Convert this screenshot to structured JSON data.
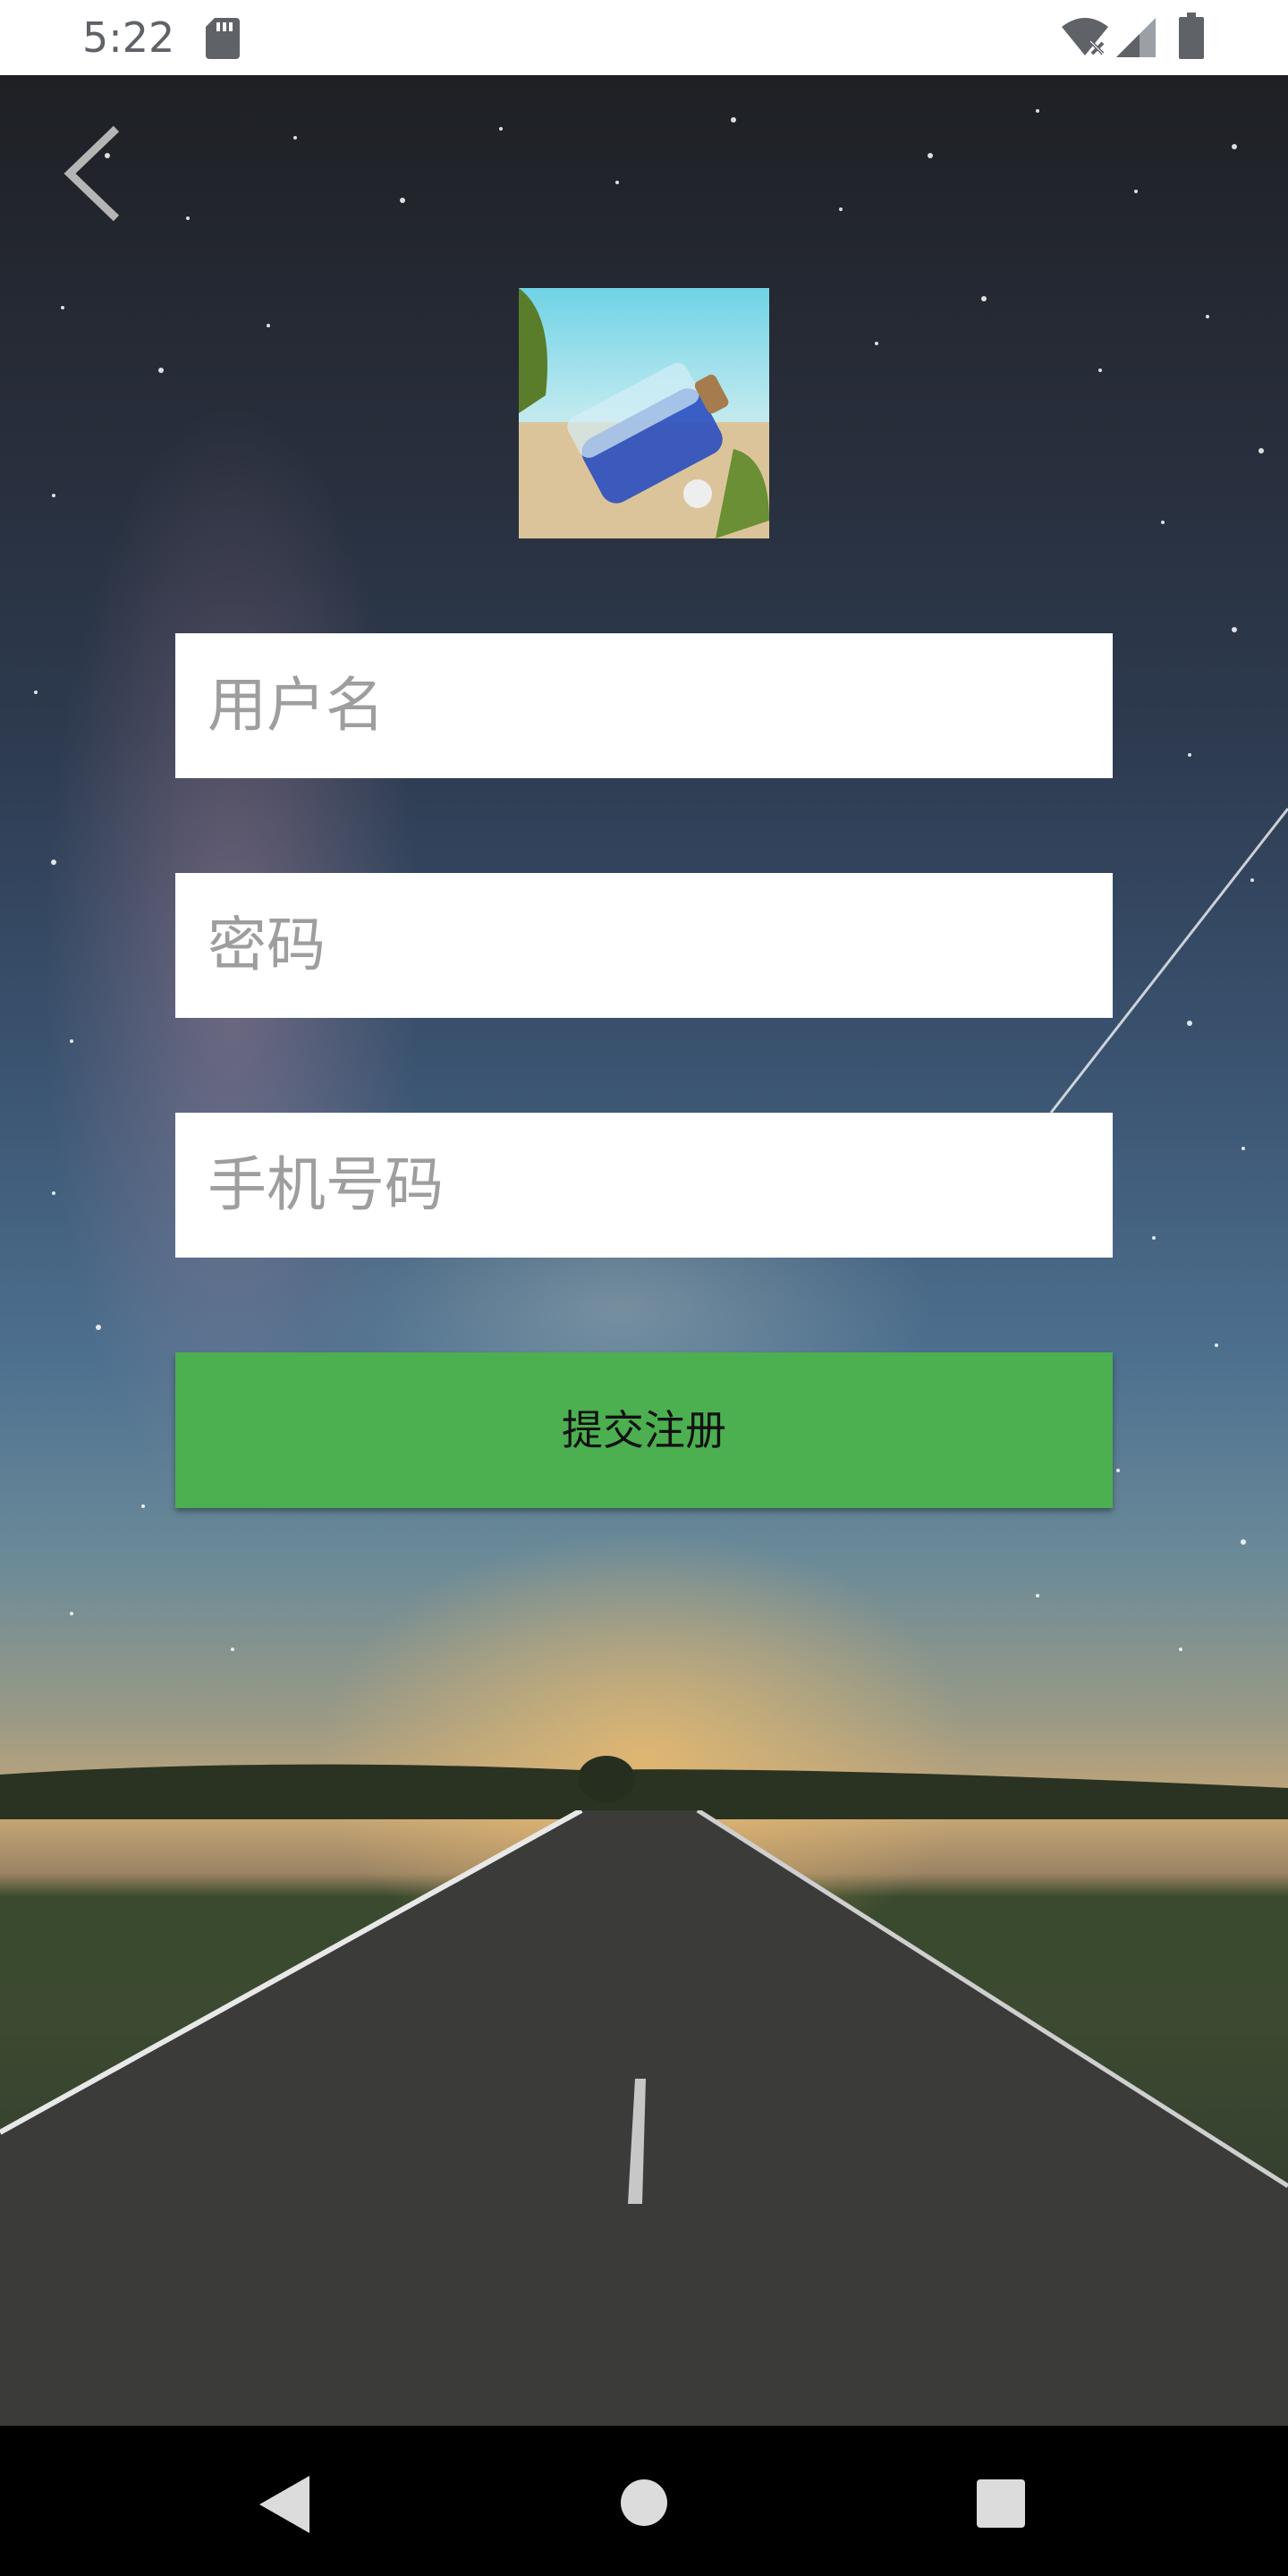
{
  "status_bar": {
    "time": "5:22",
    "icons": [
      "sd-card-icon",
      "wifi-off-icon",
      "signal-icon",
      "battery-icon"
    ]
  },
  "header": {
    "back_icon": "chevron-left-icon"
  },
  "form": {
    "username_placeholder": "用户名",
    "password_placeholder": "密码",
    "phone_placeholder": "手机号码",
    "submit_label": "提交注册"
  },
  "colors": {
    "submit_button": "#4caf50",
    "field_background": "#ffffff",
    "placeholder_text": "#9e9e9e"
  },
  "nav_bar": {
    "icons": [
      "nav-back-icon",
      "nav-home-icon",
      "nav-recents-icon"
    ]
  }
}
